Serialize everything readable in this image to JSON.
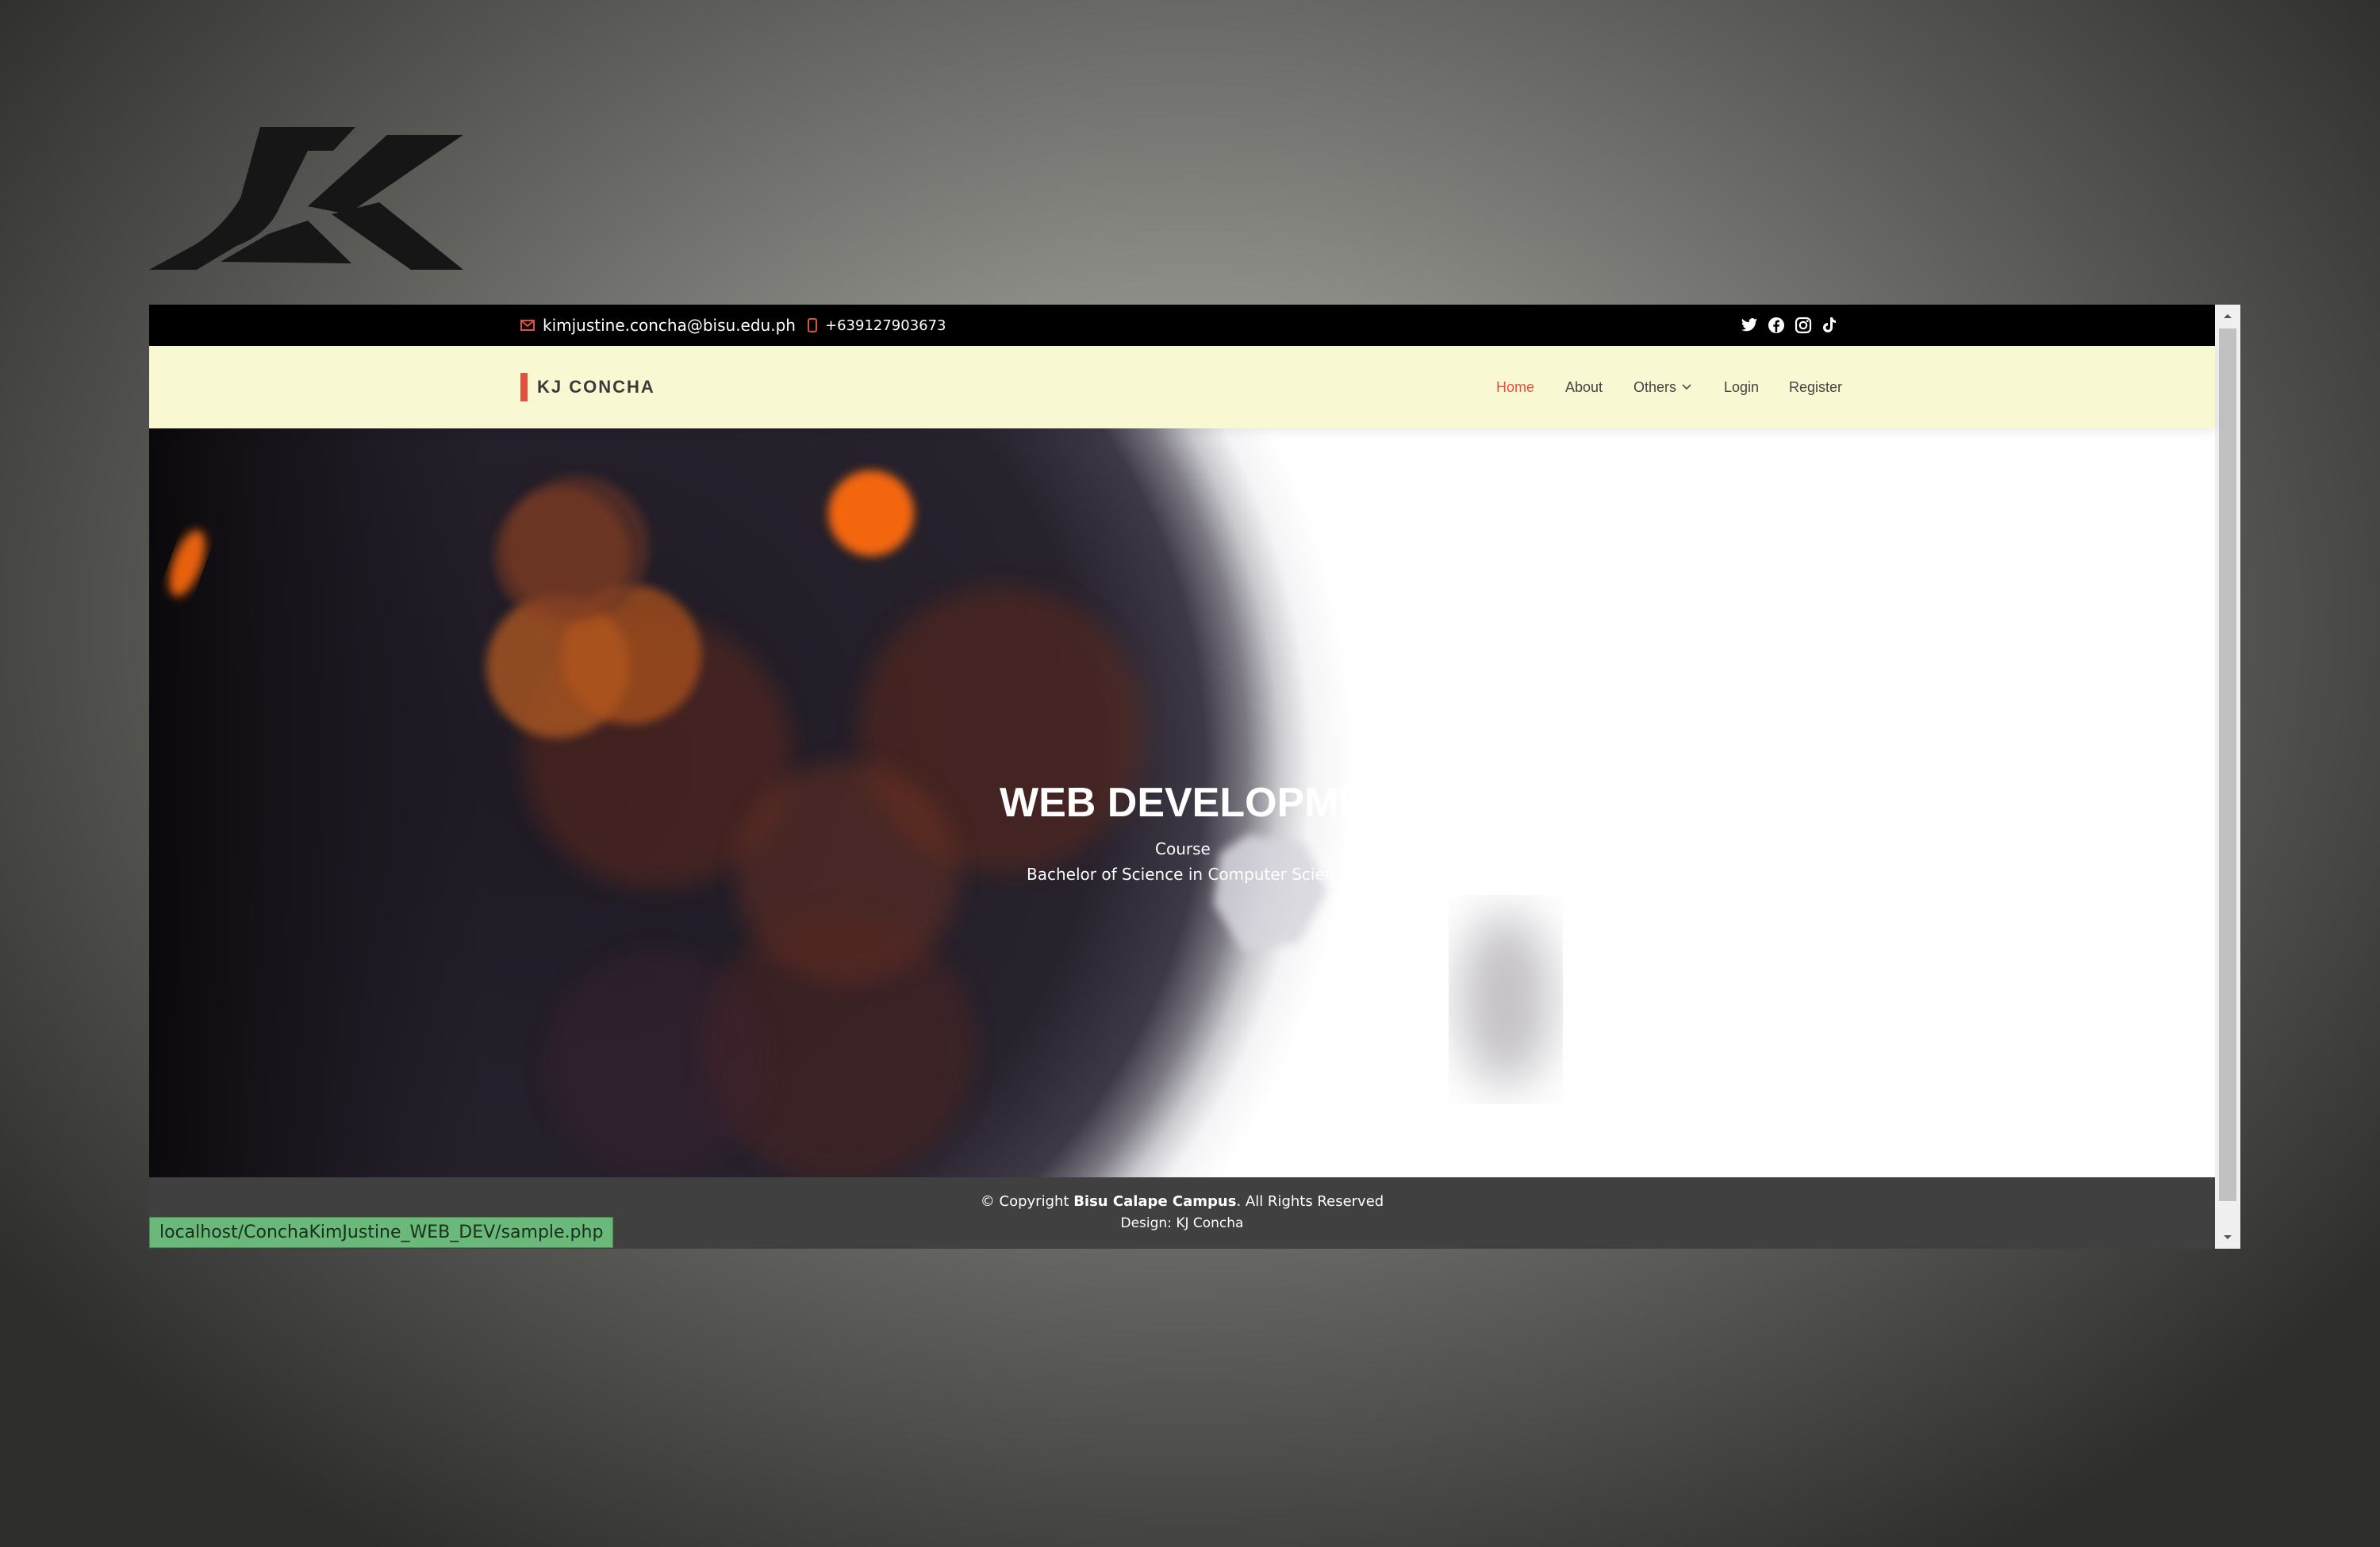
{
  "topbar": {
    "email": "kimjustine.concha@bisu.edu.ph",
    "phone": "+639127903673",
    "social_icons": [
      "twitter-icon",
      "facebook-icon",
      "instagram-icon",
      "tiktok-icon"
    ]
  },
  "navbar": {
    "brand": "KJ CONCHA",
    "links": {
      "home": "Home",
      "about": "About",
      "others": "Others",
      "login": "Login",
      "register": "Register"
    },
    "active": "Home"
  },
  "hero": {
    "title": "WEB DEVELOPMENT",
    "subtitle1": "Course",
    "subtitle2": "Bachelor of Science in Computer Science"
  },
  "footer": {
    "copyright_prefix": "© Copyright",
    "copyright_owner": "Bisu Calape Campus",
    "copyright_suffix": ". All Rights Reserved",
    "design": "Design: KJ Concha"
  },
  "status_url": "localhost/ConchaKimJustine_WEB_DEV/sample.php",
  "colors": {
    "accent": "#e0523f",
    "navbar_bg": "#f8f8d2",
    "topbar_bg": "#000000",
    "footer_bg": "#404040",
    "status_bg": "#6ab97a"
  }
}
